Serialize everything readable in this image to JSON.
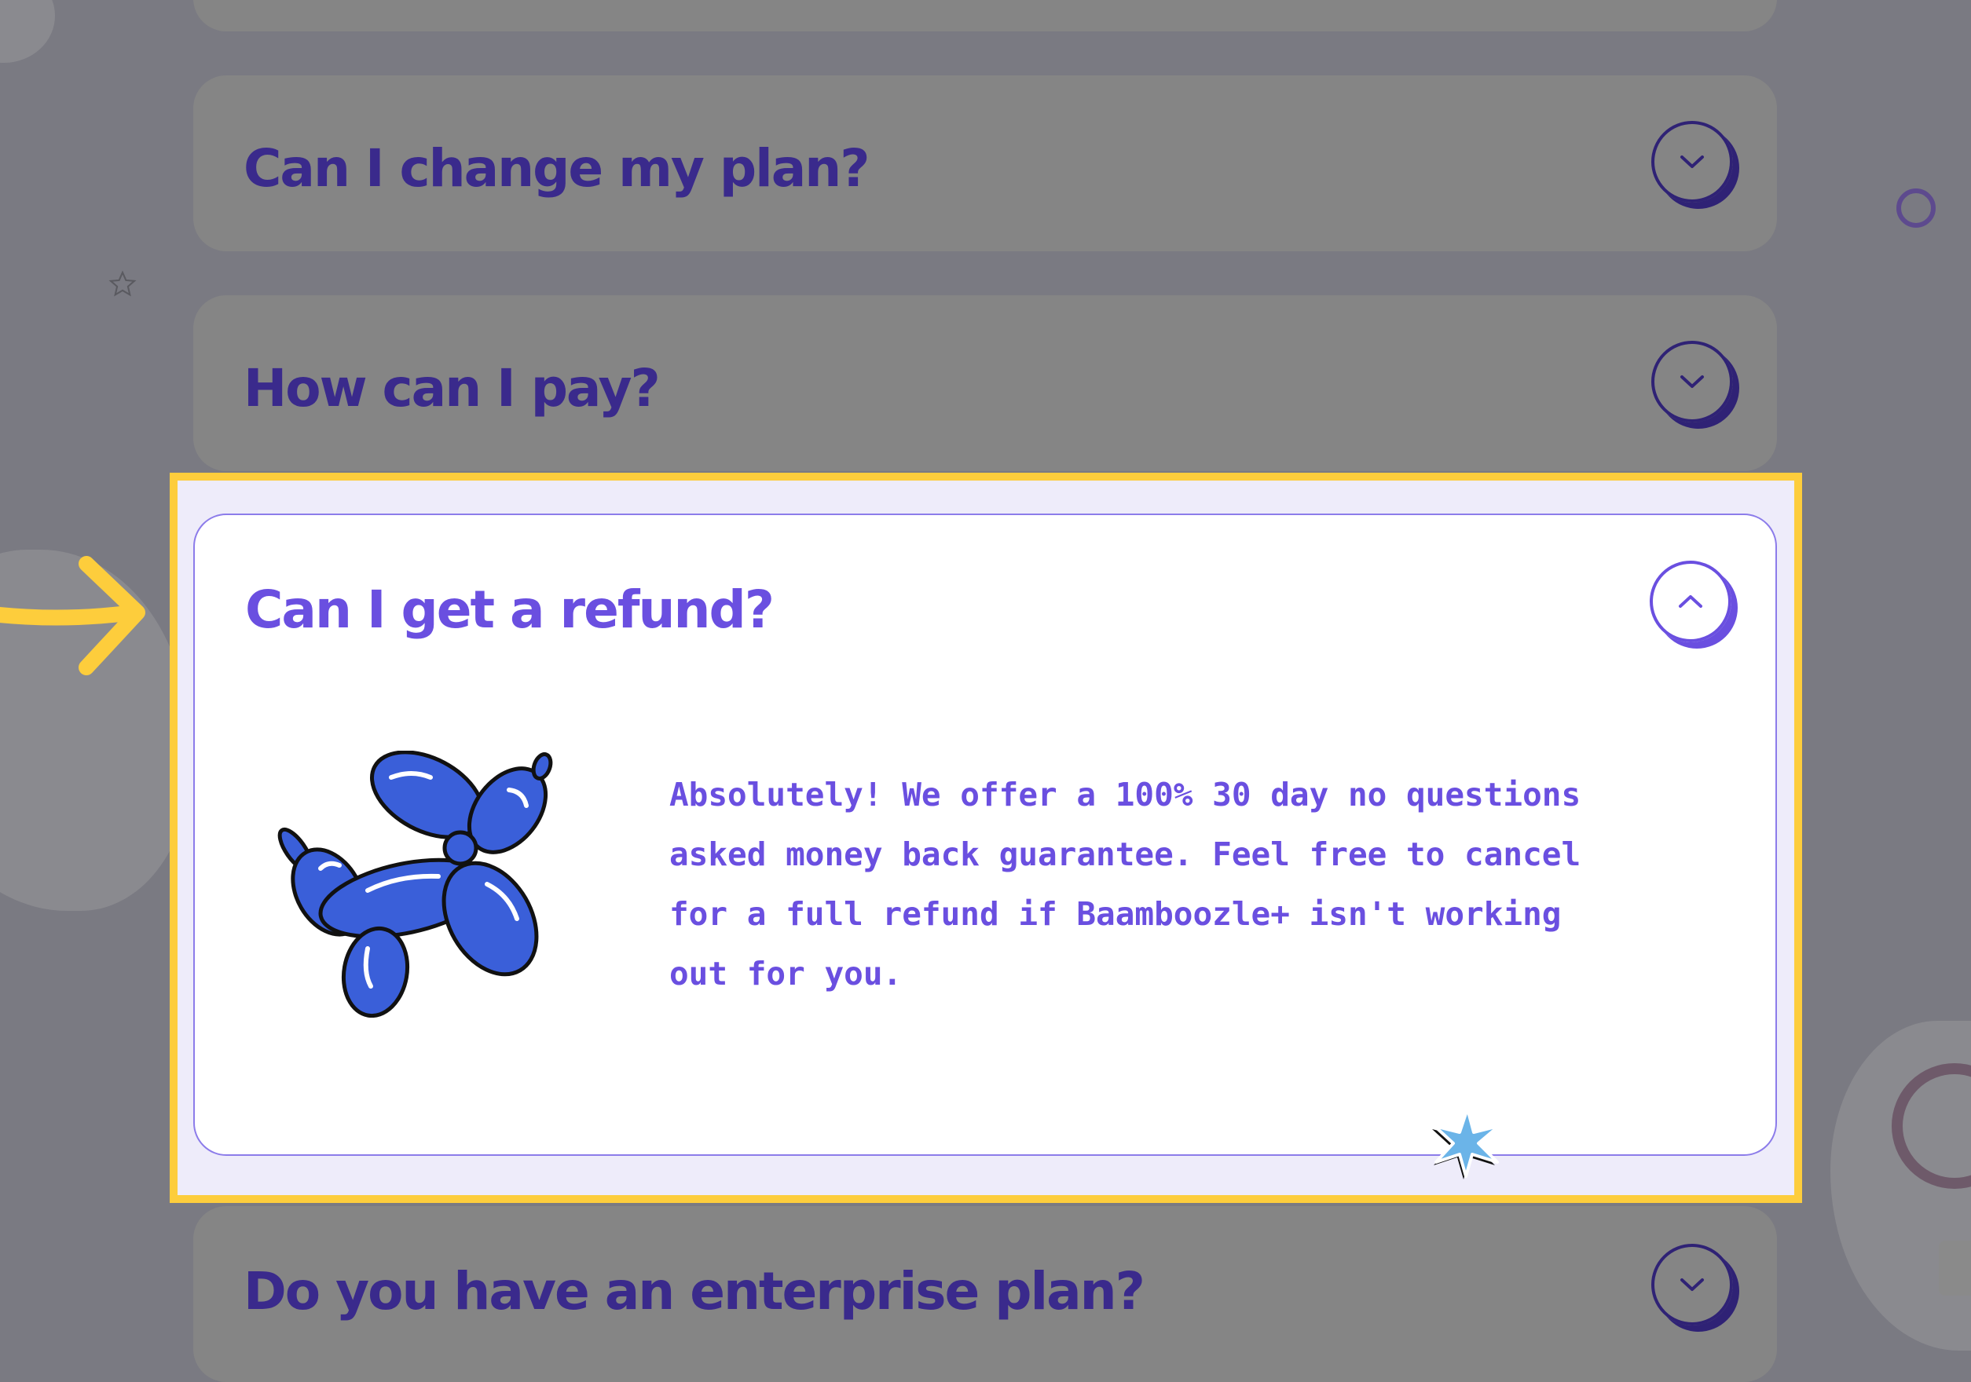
{
  "faq": {
    "items": [
      {
        "question": "Can I change my plan?",
        "expanded": false
      },
      {
        "question": "How can I pay?",
        "expanded": false
      },
      {
        "question": "Can I get a refund?",
        "expanded": true,
        "answer": "Absolutely! We offer a 100% 30 day no questions asked money back guarantee. Feel free to cancel for a full refund if Baamboozle+ isn't working out for you."
      },
      {
        "question": "Do you have an enterprise plan?",
        "expanded": false
      }
    ]
  },
  "colors": {
    "highlight": "#fdcd3c",
    "accent": "#6a4fe0",
    "question_dim": "#3a2a8c",
    "overlay_bg": "#7a7a82"
  },
  "icons": {
    "collapsed": "chevron-down-icon",
    "expanded": "chevron-up-icon",
    "illustration": "balloon-dog-icon"
  }
}
